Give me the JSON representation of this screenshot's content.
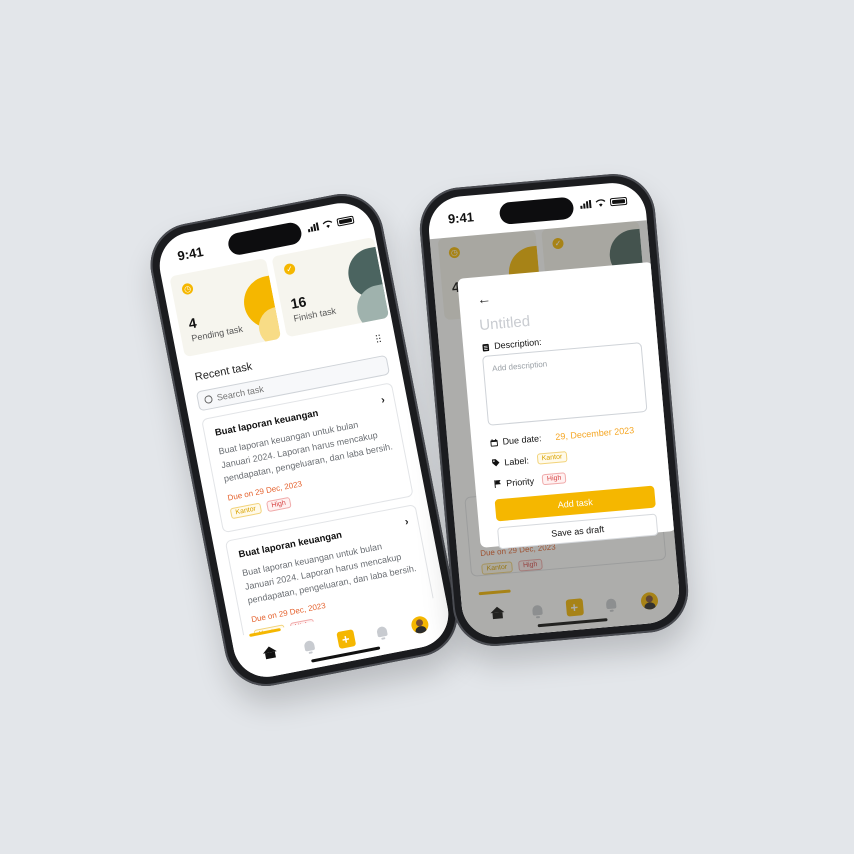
{
  "colors": {
    "accent": "#f5b700",
    "danger": "#d64545",
    "due": "#e5622e",
    "background": "#e3e6ea"
  },
  "status_bar": {
    "time": "9:41"
  },
  "summary_cards": [
    {
      "count": "4",
      "label": "Pending task",
      "icon": "clock-icon"
    },
    {
      "count": "16",
      "label": "Finish task",
      "icon": "check-icon"
    }
  ],
  "recent": {
    "title": "Recent task",
    "filter_icon": "sliders-icon"
  },
  "search": {
    "placeholder": "Search task"
  },
  "tasks": [
    {
      "title": "Buat laporan keuangan",
      "description": "Buat laporan keuangan untuk bulan Januari 2024. Laporan harus mencakup pendapatan, pengeluaran, dan laba bersih.",
      "due": "Due on 29 Dec, 2023",
      "tags": [
        "Kantor",
        "High"
      ]
    },
    {
      "title": "Buat laporan keuangan",
      "description": "Buat laporan keuangan untuk bulan Januari 2024. Laporan harus mencakup pendapatan, pengeluaran, dan laba bersih.",
      "due": "Due on 29 Dec, 2023",
      "tags": [
        "Kantor",
        "High"
      ]
    }
  ],
  "tabbar": {
    "items": [
      "home-icon",
      "bell-icon",
      "plus-icon",
      "bell-icon",
      "avatar"
    ]
  },
  "modal": {
    "title_placeholder": "Untitled",
    "description_label": "Description:",
    "description_placeholder": "Add description",
    "due_label": "Due date:",
    "due_value": "29, December 2023",
    "label_label": "Label:",
    "label_value": "Kantor",
    "priority_label": "Priority",
    "priority_value": "High",
    "add_button": "Add task",
    "draft_button": "Save as draft"
  },
  "background_peek": {
    "due": "Due on 29 Dec, 2023",
    "tags": [
      "Kantor",
      "High"
    ]
  }
}
